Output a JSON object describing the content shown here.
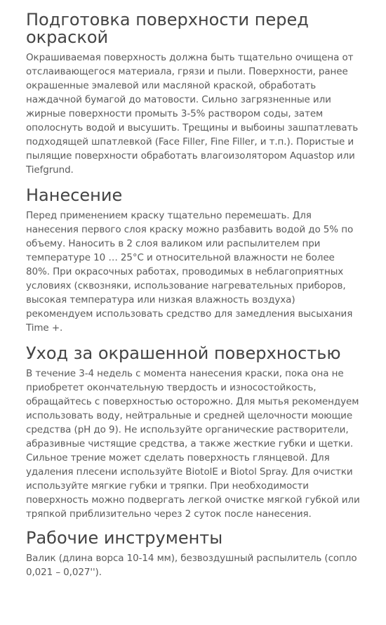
{
  "sections": [
    {
      "heading": "Подготовка поверхности перед окраской",
      "body": "Окрашиваемая поверхность должна быть тщательно очищена от отслаивающегося материала, грязи и пыли.  Поверхности, ранее окрашенные эмалевой или масляной краской, обработать наждачной бумагой до матовости. Сильно загрязненные или жирные поверхности промыть 3-5% раствором соды, затем ополоснуть водой и высушить. Трещины и выбоины зашпатлевать подходящей шпатлевкой (Face Filler, Fine Filler, и т.п.). Пористые и пылящие поверхности обработать влагоизолятором Aquastop или Tiefgrund."
    },
    {
      "heading": "Нанесение",
      "body": "Перед применением краску тщательно перемешать. Для нанесения первого слоя краску можно разбавить водой до 5% по объему. Наносить в 2 слоя валиком или распылителем при температуре 10 … 25°С и относительной влажности не более 80%. При окрасочных работах, проводимых в неблагоприятных условиях (сквозняки, использование нагревательных приборов, высокая температура или низкая влажность воздуха) рекомендуем использовать средство для замедления высыхания Time +."
    },
    {
      "heading": "Уход за окрашенной поверхностью",
      "body": "В течение 3-4 недель с момента нанесения краски, пока она не приобретет окончательную твердость и износостойкость, обращайтесь с поверхностью осторожно. Для мытья рекомендуем использовать воду, нейтральные и средней щелочности моющие средства (рН до 9). Не используйте органические растворители, абразивные чистящие средства, а также жесткие губки и щетки. Сильное трение может сделать поверхность глянцевой. Для удаления плесени используйте BiotolE и Biotol Spray. Для очистки используйте мягкие губки и тряпки. При необходимости поверхность можно подвергать легкой очистке мягкой губкой или тряпкой приблизительно через 2 суток после нанесения."
    },
    {
      "heading": "Рабочие инструменты",
      "body": "Валик (длина ворса 10-14 мм), безвоздушный распылитель (сопло 0,021 – 0,027'')."
    }
  ]
}
